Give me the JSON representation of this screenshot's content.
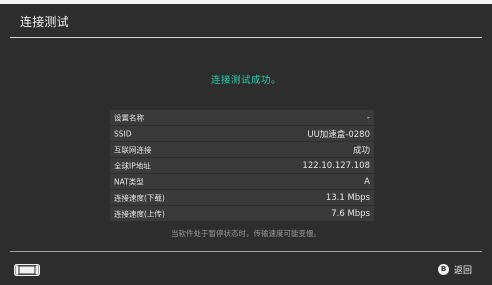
{
  "header": {
    "title": "连接测试"
  },
  "status": {
    "success_message": "连接测试成功。"
  },
  "info_rows": [
    {
      "label": "设置名称",
      "value": "-"
    },
    {
      "label": "SSID",
      "value": "UU加速盒-0280"
    },
    {
      "label": "互联网连接",
      "value": "成功"
    },
    {
      "label": "全球IP地址",
      "value": "122.10.127.108"
    },
    {
      "label": "NAT类型",
      "value": "A"
    },
    {
      "label": "连接速度(下载)",
      "value": "13.1 Mbps"
    },
    {
      "label": "连接速度(上传)",
      "value": "7.6 Mbps"
    }
  ],
  "note": "当软件处于暂停状态时，传输速度可能变慢。",
  "footer": {
    "console_icon": "switch-console-icon",
    "back_button_glyph": "B",
    "back_label": "返回"
  },
  "colors": {
    "background": "#2d2d2d",
    "success": "#19d3b3",
    "row_background": "#3a3a3a"
  }
}
